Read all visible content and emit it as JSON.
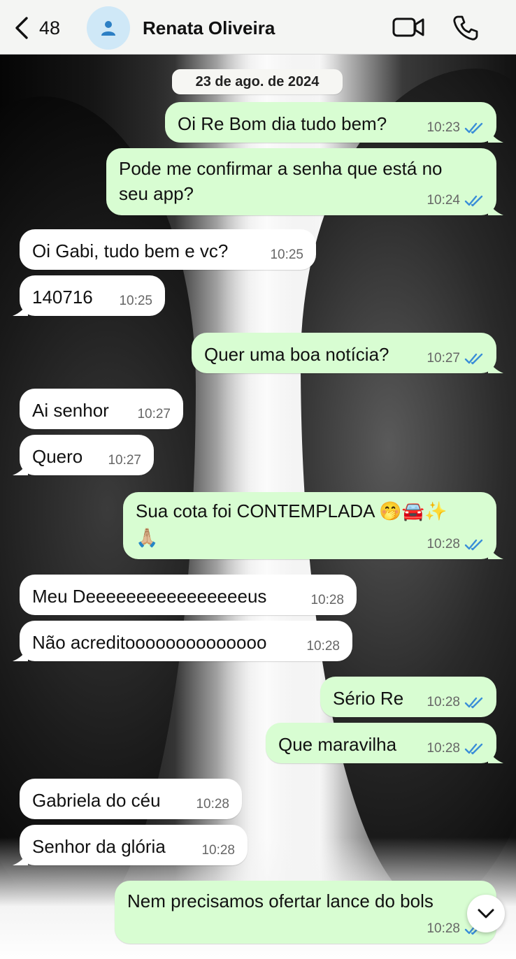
{
  "header": {
    "back_count": "48",
    "contact_name": "Renata Oliveira"
  },
  "date_separator": "23 de ago. de 2024",
  "messages": [
    {
      "dir": "out",
      "text": "Oi Re Bom dia tudo bem?",
      "time": "10:23",
      "read": true
    },
    {
      "dir": "out",
      "text_lines": [
        "Pode me confirmar a senha que está no",
        "seu app?"
      ],
      "time": "10:24",
      "read": true
    },
    {
      "dir": "in",
      "text": "Oi Gabi, tudo bem e vc?",
      "time": "10:25"
    },
    {
      "dir": "in",
      "text": "140716",
      "time": "10:25"
    },
    {
      "dir": "out",
      "text": "Quer uma boa notícia?",
      "time": "10:27",
      "read": true
    },
    {
      "dir": "in",
      "text": "Ai senhor",
      "time": "10:27"
    },
    {
      "dir": "in",
      "text": "Quero",
      "time": "10:27"
    },
    {
      "dir": "out",
      "text_lines": [
        "Sua cota foi CONTEMPLADA 🤭🚘✨",
        "🙏🏼"
      ],
      "time": "10:28",
      "read": true
    },
    {
      "dir": "in",
      "text": "Meu Deeeeeeeeeeeeeeeeus",
      "time": "10:28"
    },
    {
      "dir": "in",
      "text": "Não acreditoooooooooooooo",
      "time": "10:28"
    },
    {
      "dir": "out",
      "text": "Sério Re",
      "time": "10:28",
      "read": true
    },
    {
      "dir": "out",
      "text": "Que maravilha",
      "time": "10:28",
      "read": true
    },
    {
      "dir": "in",
      "text": "Gabriela do céu",
      "time": "10:28"
    },
    {
      "dir": "in",
      "text": "Senhor da glória",
      "time": "10:28"
    },
    {
      "dir": "out",
      "text": "Nem precisamos ofertar lance do bols",
      "time": "10:28",
      "read": true
    }
  ],
  "colors": {
    "outgoing_bubble": "#d8fdd2",
    "incoming_bubble": "#ffffff",
    "read_ticks": "#3a8ed8",
    "header_bg": "#f4f5f3"
  },
  "icons": [
    "chevron-left-icon",
    "person-icon",
    "video-camera-icon",
    "phone-icon",
    "double-check-icon",
    "chevron-down-icon"
  ]
}
